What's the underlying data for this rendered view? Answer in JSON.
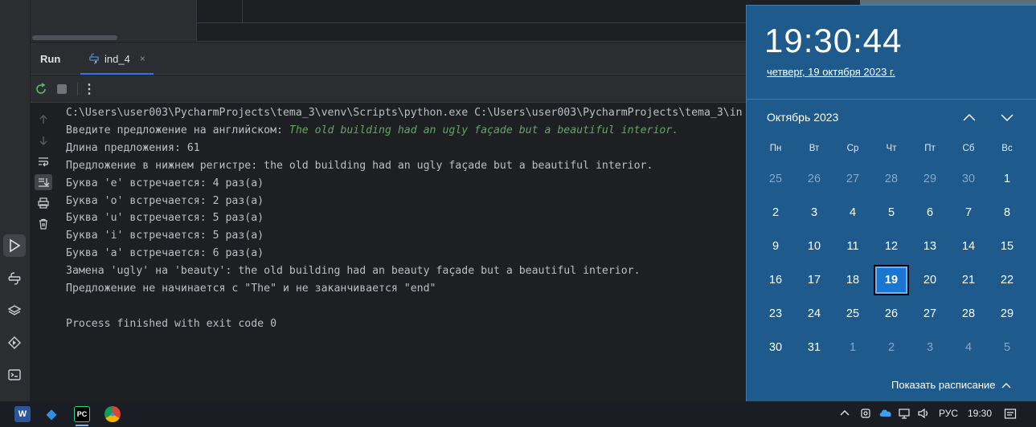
{
  "run_panel": {
    "title": "Run",
    "tab_label": "ind_4",
    "tab_close": "×"
  },
  "toolbar": {
    "rerun": "rerun-icon",
    "stop": "stop-icon",
    "more": "⋮"
  },
  "console": {
    "lines": [
      {
        "text": "C:\\Users\\user003\\PycharmProjects\\tema_3\\venv\\Scripts\\python.exe C:\\Users\\user003\\PycharmProjects\\tema_3\\in"
      },
      {
        "prompt": "Введите предложение на английском: ",
        "input": "The old building had an ugly façade but a beautiful interior."
      },
      {
        "text": "Длина предложения: 61"
      },
      {
        "text": "Предложение в нижнем регистре: the old building had an ugly façade but a beautiful interior."
      },
      {
        "text": "Буква 'e' встречается: 4 раз(а)"
      },
      {
        "text": "Буква 'o' встречается: 2 раз(а)"
      },
      {
        "text": "Буква 'u' встречается: 5 раз(а)"
      },
      {
        "text": "Буква 'i' встречается: 5 раз(а)"
      },
      {
        "text": "Буква 'a' встречается: 6 раз(а)"
      },
      {
        "text": "Замена 'ugly' на 'beauty': the old building had an beauty façade but a beautiful interior."
      },
      {
        "text": "Предложение не начинается с \"The\" и не заканчивается \"end\""
      },
      {
        "text": ""
      },
      {
        "text": "Process finished with exit code 0"
      }
    ]
  },
  "clock": {
    "time": "19:30:44",
    "date": "четверг, 19 октября 2023 г.",
    "month_title": "Октябрь 2023",
    "weekdays": [
      "Пн",
      "Вт",
      "Ср",
      "Чт",
      "Пт",
      "Сб",
      "Вс"
    ],
    "weeks": [
      [
        {
          "d": "25",
          "dim": true
        },
        {
          "d": "26",
          "dim": true
        },
        {
          "d": "27",
          "dim": true
        },
        {
          "d": "28",
          "dim": true
        },
        {
          "d": "29",
          "dim": true
        },
        {
          "d": "30",
          "dim": true
        },
        {
          "d": "1"
        }
      ],
      [
        {
          "d": "2"
        },
        {
          "d": "3"
        },
        {
          "d": "4"
        },
        {
          "d": "5"
        },
        {
          "d": "6"
        },
        {
          "d": "7"
        },
        {
          "d": "8"
        }
      ],
      [
        {
          "d": "9"
        },
        {
          "d": "10"
        },
        {
          "d": "11"
        },
        {
          "d": "12"
        },
        {
          "d": "13"
        },
        {
          "d": "14"
        },
        {
          "d": "15"
        }
      ],
      [
        {
          "d": "16"
        },
        {
          "d": "17"
        },
        {
          "d": "18"
        },
        {
          "d": "19",
          "today": true
        },
        {
          "d": "20"
        },
        {
          "d": "21"
        },
        {
          "d": "22"
        }
      ],
      [
        {
          "d": "23"
        },
        {
          "d": "24"
        },
        {
          "d": "25"
        },
        {
          "d": "26"
        },
        {
          "d": "27"
        },
        {
          "d": "28"
        },
        {
          "d": "29"
        }
      ],
      [
        {
          "d": "30"
        },
        {
          "d": "31"
        },
        {
          "d": "1",
          "dim": true
        },
        {
          "d": "2",
          "dim": true
        },
        {
          "d": "3",
          "dim": true
        },
        {
          "d": "4",
          "dim": true
        },
        {
          "d": "5",
          "dim": true
        }
      ]
    ],
    "schedule_label": "Показать расписание"
  },
  "taskbar": {
    "apps": [
      {
        "name": "word-icon",
        "glyph": "W",
        "bg": "#2b579a"
      },
      {
        "name": "sourcetree-icon",
        "glyph": "◆",
        "bg": "#1a1d24"
      },
      {
        "name": "pycharm-icon",
        "glyph": "PC",
        "bg": "#000000"
      },
      {
        "name": "chrome-icon",
        "glyph": "●",
        "bg": "#1a1d24"
      }
    ],
    "lang": "РУС",
    "time": "19:30"
  },
  "colors": {
    "ide_bg": "#1e1f22",
    "flyout_bg": "#1f5a8d",
    "today_bg": "#1976d2",
    "console_input": "#5fa862"
  }
}
